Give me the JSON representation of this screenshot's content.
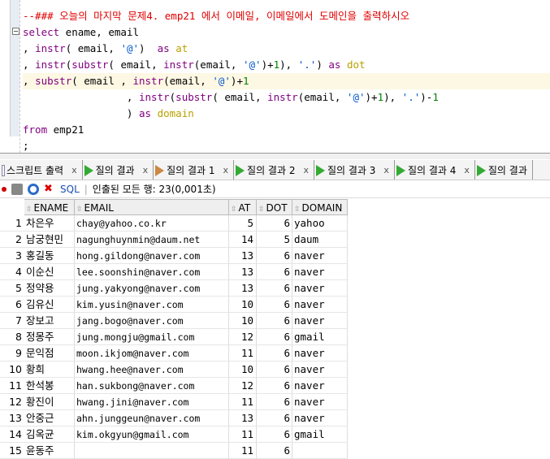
{
  "editor": {
    "lines": [
      "--### 오늘의 마지막 문제4. emp21 에서 이메일, 이메일에서 도메인을 출력하시오",
      "select ename, email",
      ", instr( email, '@')  as at",
      ", instr(substr( email, instr(email, '@')+1), '.') as dot",
      ", substr( email , instr(email, '@')+1",
      "                 , instr(substr( email, instr(email, '@')+1), '.')-1",
      "                 ) as domain",
      "from emp21",
      ";"
    ]
  },
  "tabs": [
    {
      "label": "스크립트 출력"
    },
    {
      "label": "질의 결과"
    },
    {
      "label": "질의 결과 1"
    },
    {
      "label": "질의 결과 2"
    },
    {
      "label": "질의 결과 3"
    },
    {
      "label": "질의 결과 4"
    },
    {
      "label": "질의 결과"
    }
  ],
  "tab_close": "x",
  "toolbar": {
    "sql": "SQL",
    "status": "인출된 모든 행: 23(0,001초)"
  },
  "columns": [
    "ENAME",
    "EMAIL",
    "AT",
    "DOT",
    "DOMAIN"
  ],
  "rows": [
    [
      "1",
      "차은우",
      "chay@yahoo.co.kr",
      "5",
      "6",
      "yahoo"
    ],
    [
      "2",
      "남궁현민",
      "nagunghuynmin@daum.net",
      "14",
      "5",
      "daum"
    ],
    [
      "3",
      "홍길동",
      "hong.gildong@naver.com",
      "13",
      "6",
      "naver"
    ],
    [
      "4",
      "이순신",
      "lee.soonshin@naver.com",
      "13",
      "6",
      "naver"
    ],
    [
      "5",
      "정약용",
      "jung.yakyong@naver.com",
      "13",
      "6",
      "naver"
    ],
    [
      "6",
      "김유신",
      "kim.yusin@naver.com",
      "10",
      "6",
      "naver"
    ],
    [
      "7",
      "장보고",
      "jang.bogo@naver.com",
      "10",
      "6",
      "naver"
    ],
    [
      "8",
      "정몽주",
      "jung.mongju@gmail.com",
      "12",
      "6",
      "gmail"
    ],
    [
      "9",
      "문익점",
      "moon.ikjom@naver.com",
      "11",
      "6",
      "naver"
    ],
    [
      "10",
      "황희",
      "hwang.hee@naver.com",
      "10",
      "6",
      "naver"
    ],
    [
      "11",
      "한석봉",
      "han.sukbong@naver.com",
      "12",
      "6",
      "naver"
    ],
    [
      "12",
      "황진이",
      "hwang.jini@naver.com",
      "11",
      "6",
      "naver"
    ],
    [
      "13",
      "안중근",
      "ahn.junggeun@naver.com",
      "13",
      "6",
      "naver"
    ],
    [
      "14",
      "김옥균",
      "kim.okgyun@gmail.com",
      "11",
      "6",
      "gmail"
    ],
    [
      "15",
      "윤동주",
      "",
      "11",
      "6",
      ""
    ]
  ]
}
